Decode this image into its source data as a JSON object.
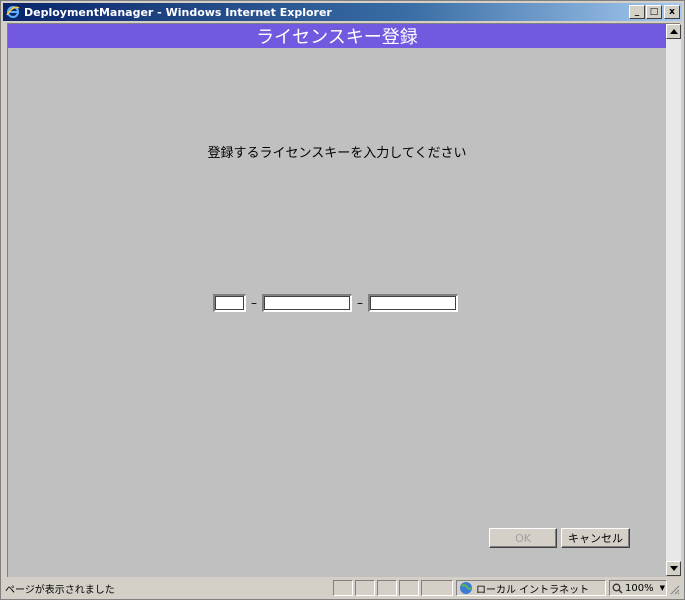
{
  "window": {
    "title": "DeploymentManager - Windows Internet Explorer",
    "minimize_glyph": "_",
    "maximize_glyph": "□",
    "close_glyph": "x"
  },
  "page": {
    "header_title": "ライセンスキー登録",
    "instruction": "登録するライセンスキーを入力してください",
    "key_separator": "–",
    "key_fields": [
      "",
      "",
      ""
    ],
    "ok_label": "OK",
    "cancel_label": "キャンセル"
  },
  "status": {
    "text": "ページが表示されました",
    "zone": "ローカル イントラネット",
    "zoom": "100%",
    "zoom_arrow": "▼"
  },
  "icons": {
    "browser": "ie-icon",
    "zone": "globe-icon",
    "zoom": "magnifier-icon"
  },
  "colors": {
    "header_bg": "#7359e0",
    "titlebar_start": "#0a246a",
    "content_bg": "#c0c0c0"
  }
}
